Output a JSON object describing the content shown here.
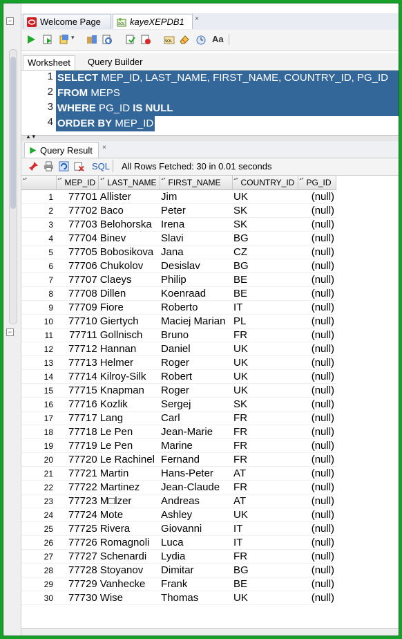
{
  "tabs": [
    {
      "label": "Welcome Page",
      "active": false
    },
    {
      "label": "kayeXEPDB1",
      "active": true
    }
  ],
  "worksheet_tabs": {
    "worksheet": "Worksheet",
    "query_builder": "Query Builder"
  },
  "sql_lines": [
    {
      "n": "1",
      "kw": "SELECT",
      "rest": " MEP_ID, LAST_NAME, FIRST_NAME, COUNTRY_ID, PG_ID"
    },
    {
      "n": "2",
      "kw": "FROM",
      "rest": " MEPS"
    },
    {
      "n": "3",
      "kw": "WHERE",
      "rest": " PG_ID ",
      "kw2": "IS NULL"
    },
    {
      "n": "4",
      "kw": "ORDER BY",
      "rest": " MEP_ID"
    }
  ],
  "results": {
    "tab_label": "Query Result",
    "sql_link": "SQL",
    "status": "All Rows Fetched: 30 in 0.01 seconds",
    "columns": [
      "MEP_ID",
      "LAST_NAME",
      "FIRST_NAME",
      "COUNTRY_ID",
      "PG_ID"
    ],
    "rows": [
      [
        "1",
        "77701",
        "Allister",
        "Jim",
        "UK",
        "(null)"
      ],
      [
        "2",
        "77702",
        "Baco",
        "Peter",
        "SK",
        "(null)"
      ],
      [
        "3",
        "77703",
        "Belohorska",
        "Irena",
        "SK",
        "(null)"
      ],
      [
        "4",
        "77704",
        "Binev",
        "Slavi",
        "BG",
        "(null)"
      ],
      [
        "5",
        "77705",
        "Bobosikova",
        "Jana",
        "CZ",
        "(null)"
      ],
      [
        "6",
        "77706",
        "Chukolov",
        "Desislav",
        "BG",
        "(null)"
      ],
      [
        "7",
        "77707",
        "Claeys",
        "Philip",
        "BE",
        "(null)"
      ],
      [
        "8",
        "77708",
        "Dillen",
        "Koenraad",
        "BE",
        "(null)"
      ],
      [
        "9",
        "77709",
        "Fiore",
        "Roberto",
        "IT",
        "(null)"
      ],
      [
        "10",
        "77710",
        "Giertych",
        "Maciej Marian",
        "PL",
        "(null)"
      ],
      [
        "11",
        "77711",
        "Gollnisch",
        "Bruno",
        "FR",
        "(null)"
      ],
      [
        "12",
        "77712",
        "Hannan",
        "Daniel",
        "UK",
        "(null)"
      ],
      [
        "13",
        "77713",
        "Helmer",
        "Roger",
        "UK",
        "(null)"
      ],
      [
        "14",
        "77714",
        "Kilroy-Silk",
        "Robert",
        "UK",
        "(null)"
      ],
      [
        "15",
        "77715",
        "Knapman",
        "Roger",
        "UK",
        "(null)"
      ],
      [
        "16",
        "77716",
        "Kozlik",
        "Sergej",
        "SK",
        "(null)"
      ],
      [
        "17",
        "77717",
        "Lang",
        "Carl",
        "FR",
        "(null)"
      ],
      [
        "18",
        "77718",
        "Le Pen",
        "Jean-Marie",
        "FR",
        "(null)"
      ],
      [
        "19",
        "77719",
        "Le Pen",
        "Marine",
        "FR",
        "(null)"
      ],
      [
        "20",
        "77720",
        "Le Rachinel",
        "Fernand",
        "FR",
        "(null)"
      ],
      [
        "21",
        "77721",
        "Martin",
        "Hans-Peter",
        "AT",
        "(null)"
      ],
      [
        "22",
        "77722",
        "Martinez",
        "Jean-Claude",
        "FR",
        "(null)"
      ],
      [
        "23",
        "77723",
        "M□lzer",
        "Andreas",
        "AT",
        "(null)"
      ],
      [
        "24",
        "77724",
        "Mote",
        "Ashley",
        "UK",
        "(null)"
      ],
      [
        "25",
        "77725",
        "Rivera",
        "Giovanni",
        "IT",
        "(null)"
      ],
      [
        "26",
        "77726",
        "Romagnoli",
        "Luca",
        "IT",
        "(null)"
      ],
      [
        "27",
        "77727",
        "Schenardi",
        "Lydia",
        "FR",
        "(null)"
      ],
      [
        "28",
        "77728",
        "Stoyanov",
        "Dimitar",
        "BG",
        "(null)"
      ],
      [
        "29",
        "77729",
        "Vanhecke",
        "Frank",
        "BE",
        "(null)"
      ],
      [
        "30",
        "77730",
        "Wise",
        "Thomas",
        "UK",
        "(null)"
      ]
    ]
  },
  "colors": {
    "frame": "#17a12a",
    "selection": "#336699"
  }
}
